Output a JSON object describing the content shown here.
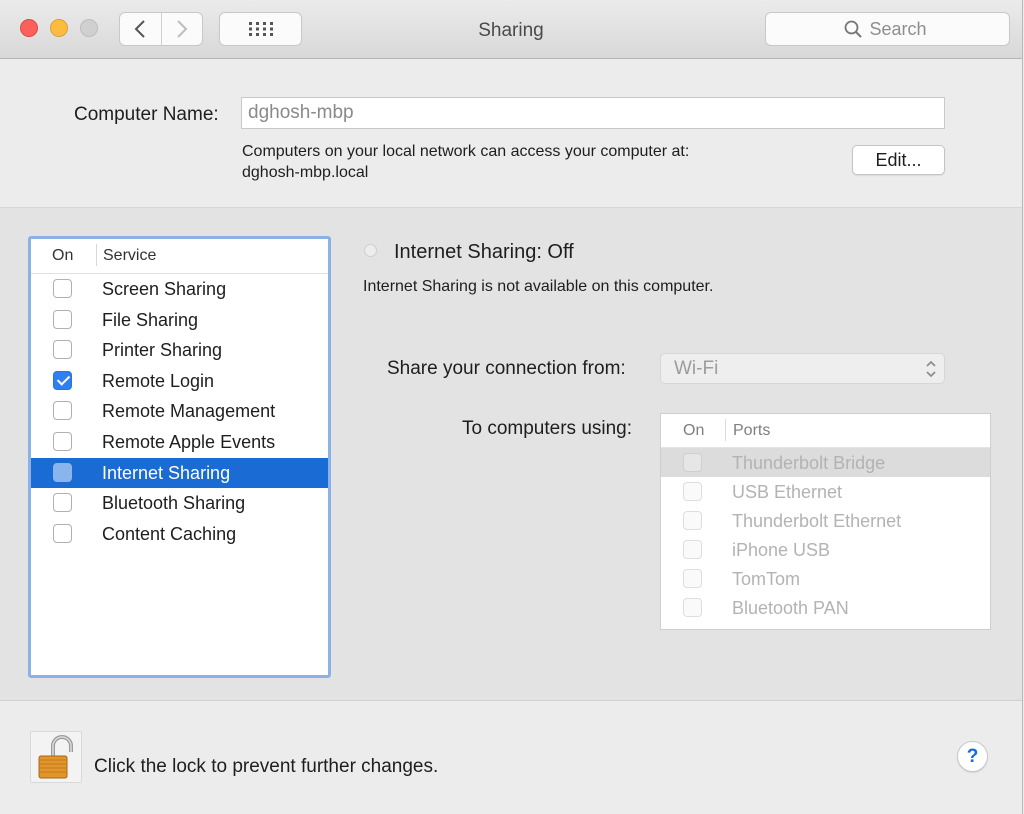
{
  "window": {
    "title": "Sharing"
  },
  "toolbar": {
    "search_placeholder": "Search",
    "back_icon": "chevron-left-icon",
    "forward_icon": "chevron-right-icon",
    "grid_icon": "grid-icon"
  },
  "computer": {
    "name_label": "Computer Name:",
    "name_value": "dghosh-mbp",
    "desc_line1": "Computers on your local network can access your computer at:",
    "desc_line2": "dghosh-mbp.local",
    "edit_label": "Edit..."
  },
  "services": {
    "col_on": "On",
    "col_service": "Service",
    "items": [
      {
        "label": "Screen Sharing",
        "checked": false,
        "selected": false
      },
      {
        "label": "File Sharing",
        "checked": false,
        "selected": false
      },
      {
        "label": "Printer Sharing",
        "checked": false,
        "selected": false
      },
      {
        "label": "Remote Login",
        "checked": true,
        "selected": false
      },
      {
        "label": "Remote Management",
        "checked": false,
        "selected": false
      },
      {
        "label": "Remote Apple Events",
        "checked": false,
        "selected": false
      },
      {
        "label": "Internet Sharing",
        "checked": false,
        "selected": true
      },
      {
        "label": "Bluetooth Sharing",
        "checked": false,
        "selected": false
      },
      {
        "label": "Content Caching",
        "checked": false,
        "selected": false
      }
    ]
  },
  "detail": {
    "status_title": "Internet Sharing: Off",
    "status_desc": "Internet Sharing is not available on this computer.",
    "share_from_label": "Share your connection from:",
    "share_from_value": "Wi-Fi",
    "to_computers_label": "To computers using:",
    "ports_col_on": "On",
    "ports_col_ports": "Ports",
    "ports": [
      {
        "label": "Thunderbolt Bridge",
        "selected": true
      },
      {
        "label": "USB Ethernet",
        "selected": false
      },
      {
        "label": "Thunderbolt Ethernet",
        "selected": false
      },
      {
        "label": "iPhone USB",
        "selected": false
      },
      {
        "label": "TomTom",
        "selected": false
      },
      {
        "label": "Bluetooth PAN",
        "selected": false
      }
    ]
  },
  "footer": {
    "lock_text": "Click the lock to prevent further changes.",
    "help_label": "?"
  },
  "colors": {
    "selection": "#1a6bd3",
    "focus_ring": "#8ab2e6",
    "checkbox_checked": "#2d7ff3"
  }
}
